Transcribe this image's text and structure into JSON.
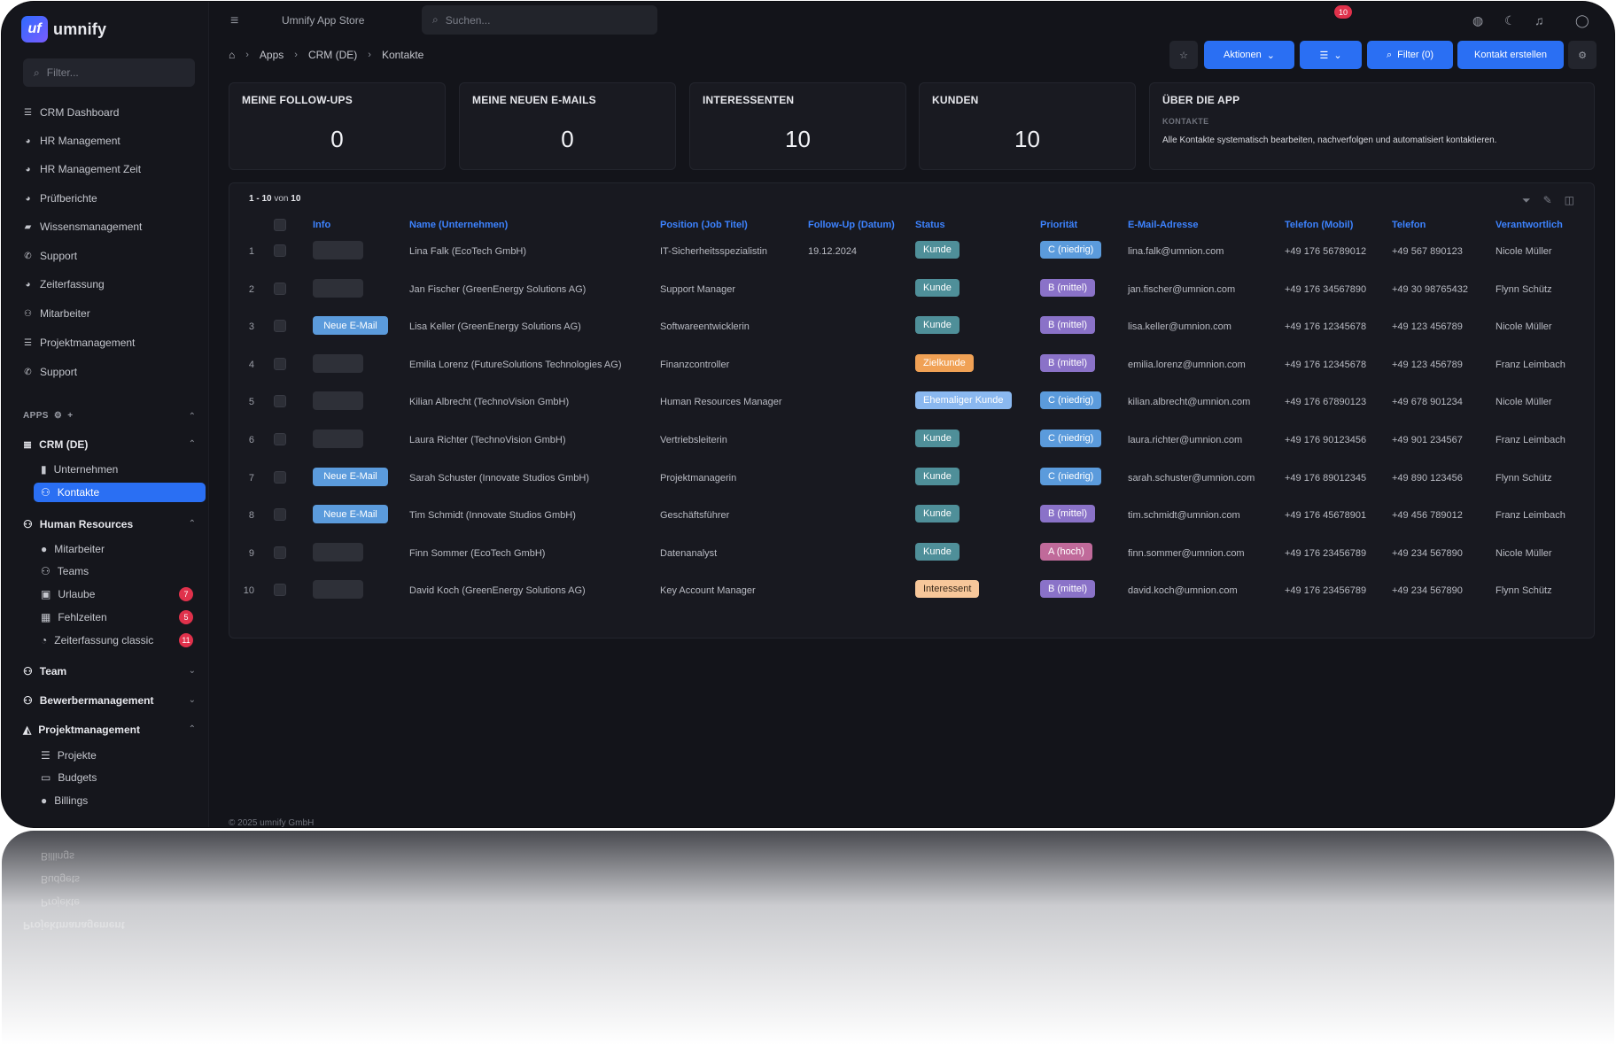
{
  "app": {
    "logo_mark": "uf",
    "logo_text": "umnify",
    "store_title": "Umnify App Store",
    "footer": "© 2025 umnify GmbH"
  },
  "search": {
    "placeholder": "Suchen..."
  },
  "topbar": {
    "notifications": "10"
  },
  "sidebar": {
    "filter_placeholder": "Filter...",
    "items": [
      "CRM Dashboard",
      "HR Management",
      "HR Management Zeit",
      "Prüfberichte",
      "Wissensmanagement",
      "Support",
      "Zeiterfassung",
      "Mitarbeiter",
      "Projektmanagement",
      "Support"
    ],
    "apps_label": "APPS",
    "crm": {
      "label": "CRM (DE)",
      "subs": [
        "Unternehmen",
        "Kontakte"
      ]
    },
    "hr": {
      "label": "Human Resources",
      "subs": [
        {
          "label": "Mitarbeiter",
          "badge": ""
        },
        {
          "label": "Teams",
          "badge": ""
        },
        {
          "label": "Urlaube",
          "badge": "7"
        },
        {
          "label": "Fehlzeiten",
          "badge": "5"
        },
        {
          "label": "Zeiterfassung classic",
          "badge": "11"
        }
      ]
    },
    "team": "Team",
    "bewerber": "Bewerbermanagement",
    "projekt": {
      "label": "Projektmanagement",
      "subs": [
        "Projekte",
        "Budgets",
        "Billings"
      ]
    }
  },
  "breadcrumb": {
    "items": [
      "Apps",
      "CRM (DE)",
      "Kontakte"
    ]
  },
  "actions": {
    "aktionen": "Aktionen",
    "filter": "Filter (0)",
    "create": "Kontakt erstellen"
  },
  "cards": {
    "followups": {
      "title": "MEINE FOLLOW-UPS",
      "value": "0"
    },
    "emails": {
      "title": "MEINE NEUEN E-MAILS",
      "value": "0"
    },
    "interessenten": {
      "title": "INTERESSENTEN",
      "value": "10"
    },
    "kunden": {
      "title": "KUNDEN",
      "value": "10"
    },
    "about": {
      "title": "ÜBER DIE APP",
      "sub": "KONTAKTE",
      "desc": "Alle Kontakte systematisch bearbeiten, nachverfolgen und automatisiert kontaktieren."
    }
  },
  "table": {
    "pager": {
      "range": "1 - 10",
      "von": "von",
      "total": "10"
    },
    "headers": [
      "Info",
      "Name (Unternehmen)",
      "Position (Job Titel)",
      "Follow-Up (Datum)",
      "Status",
      "Priorität",
      "E-Mail-Adresse",
      "Telefon (Mobil)",
      "Telefon",
      "Verantwortlich"
    ],
    "rows": [
      {
        "n": "1",
        "info": "",
        "name": "Lina Falk (EcoTech GmbH)",
        "position": "IT-Sicherheitsspezialistin",
        "followup": "19.12.2024",
        "status": "Kunde",
        "prio": "C (niedrig)",
        "email": "lina.falk@umnion.com",
        "mobil": "+49 176 56789012",
        "tel": "+49 567 890123",
        "owner": "Nicole Müller"
      },
      {
        "n": "2",
        "info": "",
        "name": "Jan Fischer (GreenEnergy Solutions AG)",
        "position": "Support Manager",
        "followup": "",
        "status": "Kunde",
        "prio": "B (mittel)",
        "email": "jan.fischer@umnion.com",
        "mobil": "+49 176 34567890",
        "tel": "+49 30 98765432",
        "owner": "Flynn Schütz"
      },
      {
        "n": "3",
        "info": "Neue E-Mail",
        "name": "Lisa Keller (GreenEnergy Solutions AG)",
        "position": "Softwareentwicklerin",
        "followup": "",
        "status": "Kunde",
        "prio": "B (mittel)",
        "email": "lisa.keller@umnion.com",
        "mobil": "+49 176 12345678",
        "tel": "+49 123 456789",
        "owner": "Nicole Müller"
      },
      {
        "n": "4",
        "info": "",
        "name": "Emilia Lorenz (FutureSolutions Technologies AG)",
        "position": "Finanzcontroller",
        "followup": "",
        "status": "Zielkunde",
        "prio": "B (mittel)",
        "email": "emilia.lorenz@umnion.com",
        "mobil": "+49 176 12345678",
        "tel": "+49 123 456789",
        "owner": "Franz Leimbach"
      },
      {
        "n": "5",
        "info": "",
        "name": "Kilian Albrecht (TechnoVision GmbH)",
        "position": "Human Resources Manager",
        "followup": "",
        "status": "Ehemaliger Kunde",
        "prio": "C (niedrig)",
        "email": "kilian.albrecht@umnion.com",
        "mobil": "+49 176 67890123",
        "tel": "+49 678 901234",
        "owner": "Nicole Müller"
      },
      {
        "n": "6",
        "info": "",
        "name": "Laura Richter (TechnoVision GmbH)",
        "position": "Vertriebsleiterin",
        "followup": "",
        "status": "Kunde",
        "prio": "C (niedrig)",
        "email": "laura.richter@umnion.com",
        "mobil": "+49 176 90123456",
        "tel": "+49 901 234567",
        "owner": "Franz Leimbach"
      },
      {
        "n": "7",
        "info": "Neue E-Mail",
        "name": "Sarah Schuster (Innovate Studios GmbH)",
        "position": "Projektmanagerin",
        "followup": "",
        "status": "Kunde",
        "prio": "C (niedrig)",
        "email": "sarah.schuster@umnion.com",
        "mobil": "+49 176 89012345",
        "tel": "+49 890 123456",
        "owner": "Flynn Schütz"
      },
      {
        "n": "8",
        "info": "Neue E-Mail",
        "name": "Tim Schmidt (Innovate Studios GmbH)",
        "position": "Geschäftsführer",
        "followup": "",
        "status": "Kunde",
        "prio": "B (mittel)",
        "email": "tim.schmidt@umnion.com",
        "mobil": "+49 176 45678901",
        "tel": "+49 456 789012",
        "owner": "Franz Leimbach"
      },
      {
        "n": "9",
        "info": "",
        "name": "Finn Sommer (EcoTech GmbH)",
        "position": "Datenanalyst",
        "followup": "",
        "status": "Kunde",
        "prio": "A (hoch)",
        "email": "finn.sommer@umnion.com",
        "mobil": "+49 176 23456789",
        "tel": "+49 234 567890",
        "owner": "Nicole Müller"
      },
      {
        "n": "10",
        "info": "",
        "name": "David Koch (GreenEnergy Solutions AG)",
        "position": "Key Account Manager",
        "followup": "",
        "status": "Interessent",
        "prio": "B (mittel)",
        "email": "david.koch@umnion.com",
        "mobil": "+49 176 23456789",
        "tel": "+49 234 567890",
        "owner": "Flynn Schütz"
      }
    ]
  },
  "colors": {
    "accent": "#2a6ff3",
    "status": {
      "Kunde": "#4f8f99",
      "Zielkunde": "#f0a155",
      "Ehemaliger Kunde": "#8ab8f0",
      "Interessent": "#f7c79a"
    },
    "prio": {
      "C (niedrig)": "#5b9bdc",
      "B (mittel)": "#8a72c8",
      "A (hoch)": "#c06a9a"
    }
  }
}
